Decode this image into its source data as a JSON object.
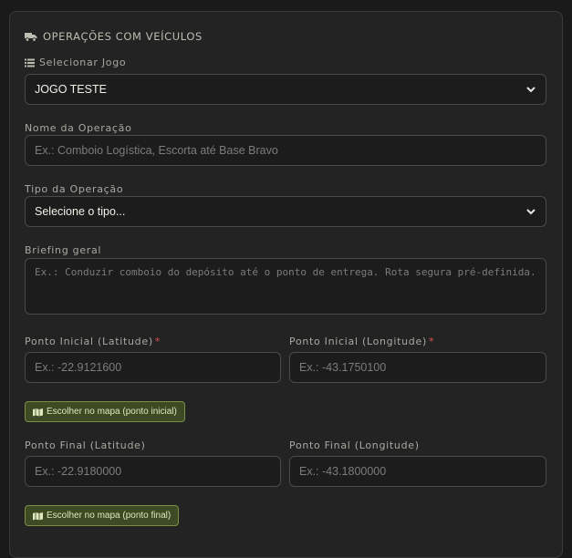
{
  "section": {
    "title": "OPERAÇÕES COM VEÍCULOS",
    "icon": "truck-icon"
  },
  "game": {
    "label": "Selecionar Jogo",
    "icon": "list-icon",
    "selected": "JOGO TESTE"
  },
  "operation_name": {
    "label": "Nome da Operação",
    "placeholder": "Ex.: Comboio Logística, Escorta até Base Bravo"
  },
  "operation_type": {
    "label": "Tipo da Operação",
    "selected": "Selecione o tipo..."
  },
  "briefing": {
    "label": "Briefing geral",
    "placeholder": "Ex.: Conduzir comboio do depósito até o ponto de entrega. Rota segura pré-definida."
  },
  "start_point": {
    "lat_label": "Ponto Inicial (Latitude)",
    "lat_required": "*",
    "lat_placeholder": "Ex.: -22.9121600",
    "lng_label": "Ponto Inicial (Longitude)",
    "lng_required": "*",
    "lng_placeholder": "Ex.: -43.1750100",
    "map_button": "Escolher no mapa (ponto inicial)"
  },
  "end_point": {
    "lat_label": "Ponto Final (Latitude)",
    "lat_placeholder": "Ex.: -22.9180000",
    "lng_label": "Ponto Final (Longitude)",
    "lng_placeholder": "Ex.: -43.1800000",
    "map_button": "Escolher no mapa (ponto final)"
  },
  "colors": {
    "accent_button_bg": "#3d4a23",
    "accent_button_border": "#7d8f45",
    "required": "#d9534f"
  }
}
